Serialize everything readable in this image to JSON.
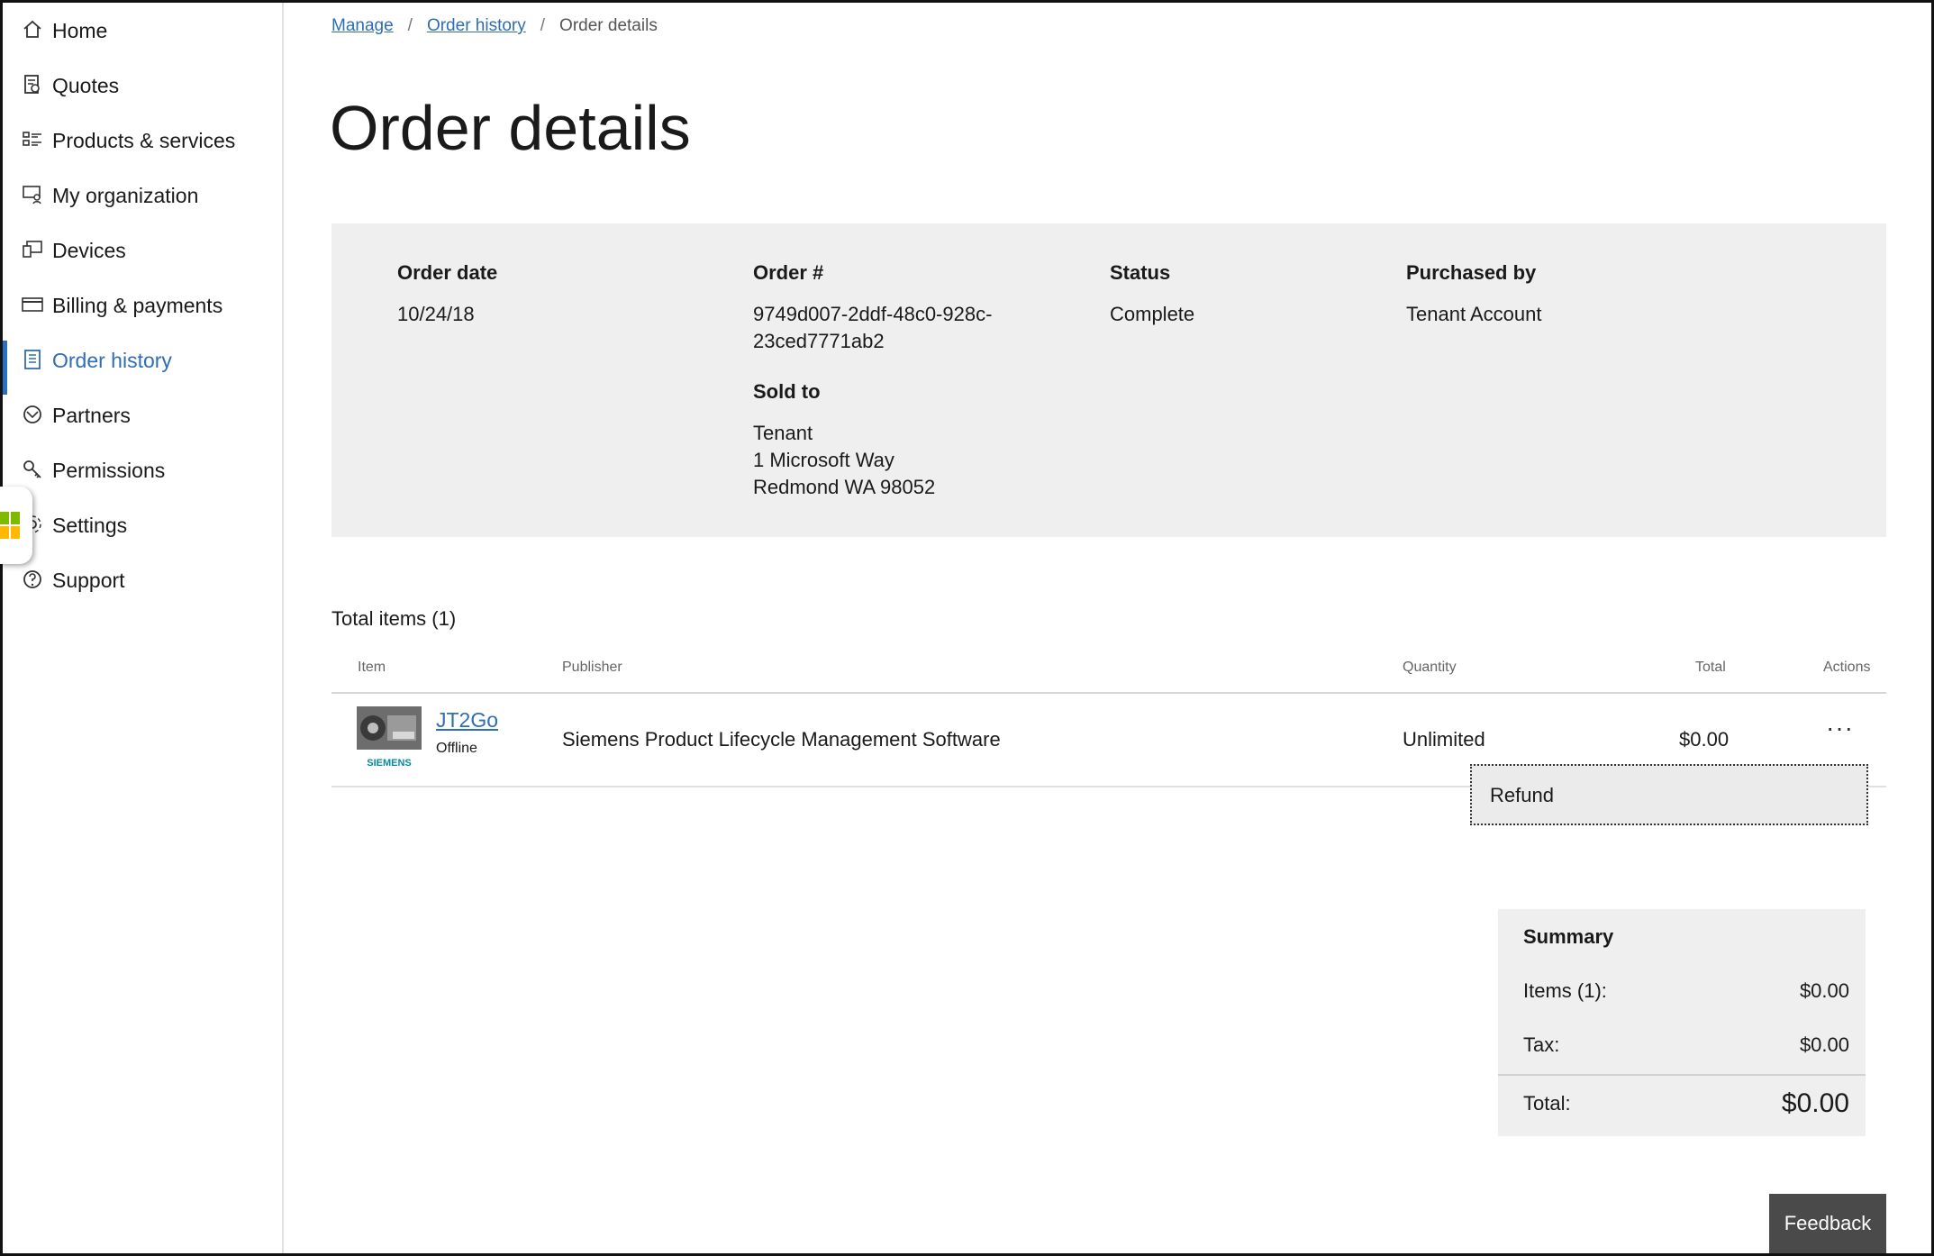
{
  "sidebar": {
    "items": [
      {
        "label": "Home",
        "icon": "home-icon"
      },
      {
        "label": "Quotes",
        "icon": "quotes-icon"
      },
      {
        "label": "Products & services",
        "icon": "products-icon"
      },
      {
        "label": "My organization",
        "icon": "organization-icon"
      },
      {
        "label": "Devices",
        "icon": "devices-icon"
      },
      {
        "label": "Billing & payments",
        "icon": "billing-icon"
      },
      {
        "label": "Order history",
        "icon": "order-history-icon",
        "active": true
      },
      {
        "label": "Partners",
        "icon": "partners-icon"
      },
      {
        "label": "Permissions",
        "icon": "permissions-icon"
      },
      {
        "label": "Settings",
        "icon": "settings-icon"
      },
      {
        "label": "Support",
        "icon": "support-icon"
      }
    ]
  },
  "breadcrumb": {
    "manage": "Manage",
    "order_history": "Order history",
    "current": "Order details",
    "separator": "/"
  },
  "page_title": "Order details",
  "order": {
    "order_date_label": "Order date",
    "order_date": "10/24/18",
    "order_number_label": "Order #",
    "order_number_line1": "9749d007-2ddf-48c0-928c-",
    "order_number_line2": "23ced7771ab2",
    "status_label": "Status",
    "status": "Complete",
    "purchased_by_label": "Purchased by",
    "purchased_by": "Tenant Account",
    "sold_to_label": "Sold to",
    "sold_to_line1": "Tenant",
    "sold_to_line2": "1 Microsoft Way",
    "sold_to_line3": "Redmond WA 98052"
  },
  "items_section": {
    "total_items": "Total items (1)",
    "columns": {
      "item": "Item",
      "publisher": "Publisher",
      "quantity": "Quantity",
      "total": "Total",
      "actions": "Actions"
    },
    "rows": [
      {
        "name": "JT2Go",
        "subtitle": "Offline",
        "logo_text": "SIEMENS",
        "publisher": "Siemens Product Lifecycle Management Software",
        "quantity": "Unlimited",
        "total": "$0.00",
        "actions": "···"
      }
    ],
    "menu": {
      "refund": "Refund"
    }
  },
  "summary": {
    "title": "Summary",
    "items_label": "Items (1):",
    "items_value": "$0.00",
    "tax_label": "Tax:",
    "tax_value": "$0.00",
    "total_label": "Total:",
    "total_value": "$0.00"
  },
  "feedback": "Feedback",
  "colors": {
    "accent": "#2f6db5",
    "panel": "#efefef",
    "feedback_bg": "#4a4a4a"
  }
}
